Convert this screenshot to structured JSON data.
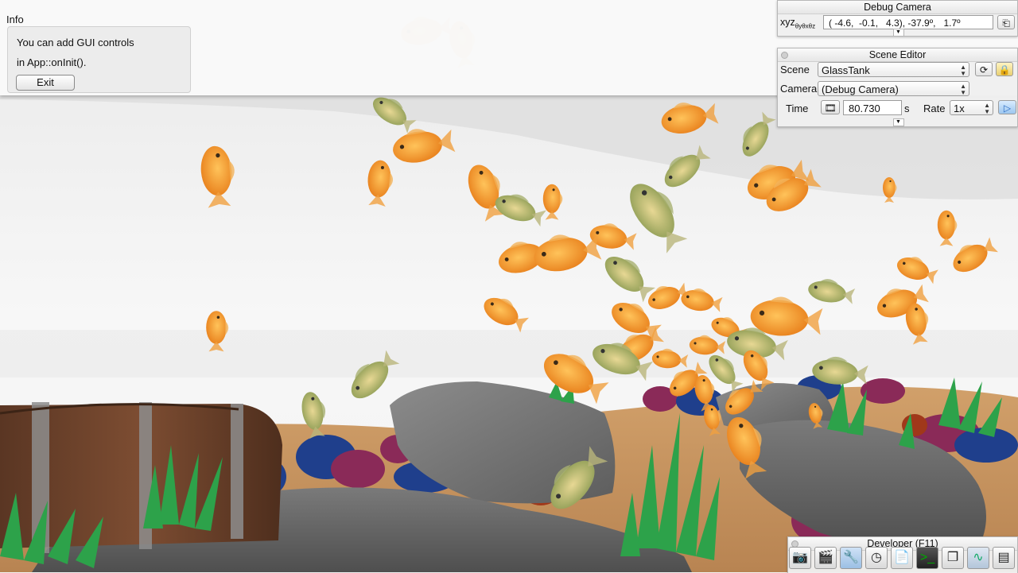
{
  "info_window": {
    "title": "Info",
    "lines": [
      "You can add GUI controls",
      "in App::onInit()."
    ],
    "exit_label": "Exit"
  },
  "debug_camera": {
    "title": "Debug Camera",
    "xyz_label": "xyz",
    "xyz_sub": "θyθxθz",
    "coords": "( -4.6,  -0.1,   4.3), -37.9º,   1.7º",
    "copy_icon": "clipboard-icon"
  },
  "scene_editor": {
    "title": "Scene Editor",
    "scene_label": "Scene",
    "scene_value": "GlassTank",
    "reload_icon": "reload-icon",
    "lock_icon": "lock-icon",
    "camera_label": "Camera",
    "camera_value": "(Debug Camera)",
    "time_label": "Time",
    "time_value": "80.730",
    "time_unit": "s",
    "rate_label": "Rate",
    "rate_value": "1x",
    "play_icon": "play-icon"
  },
  "developer": {
    "title": "Developer (F11)",
    "icons": [
      "camera-icon",
      "film-clapper-icon",
      "tools-icon",
      "clock-icon",
      "new-document-icon",
      "terminal-icon",
      "windows-icon",
      "profiler-icon",
      "log-document-icon"
    ]
  }
}
